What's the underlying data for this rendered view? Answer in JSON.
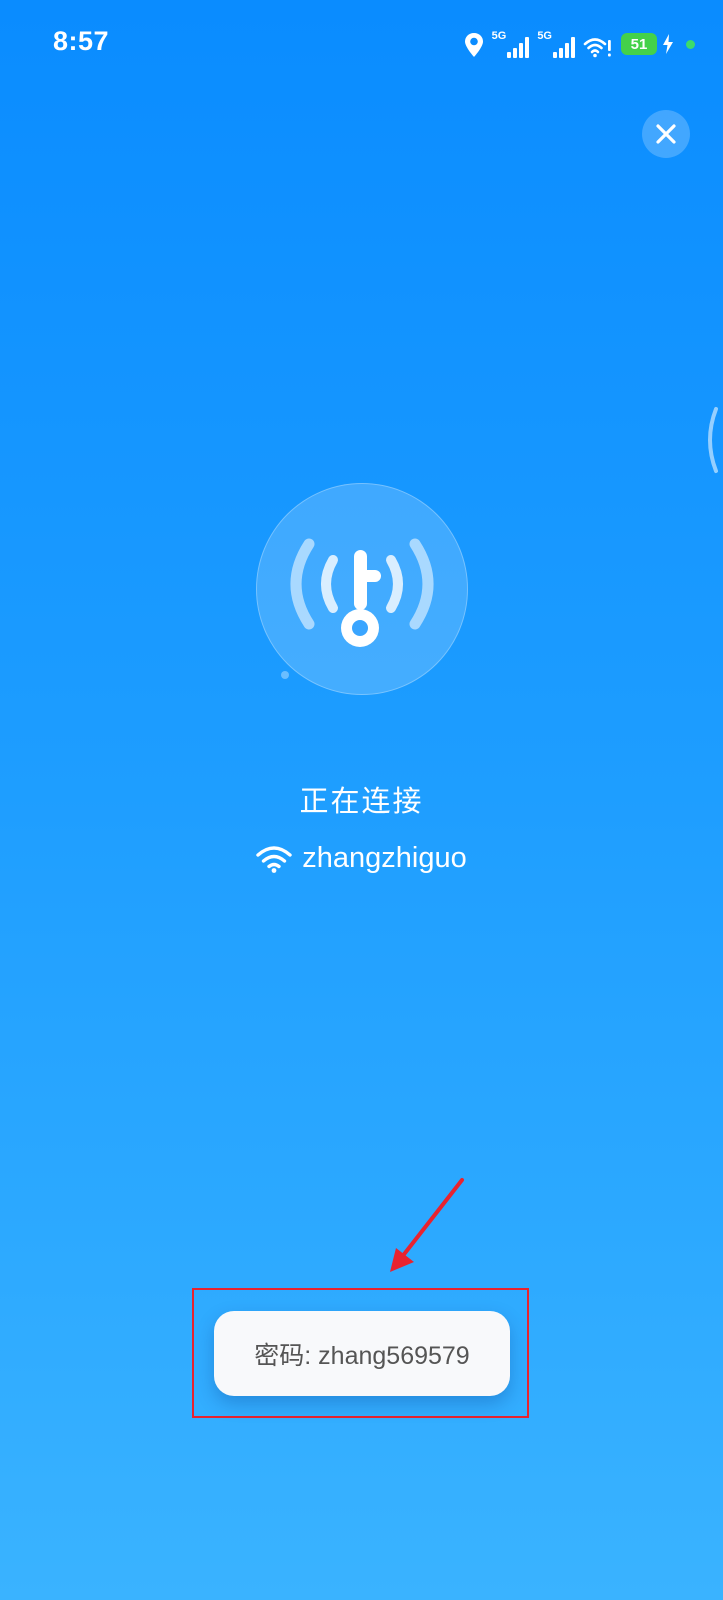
{
  "status_bar": {
    "time": "8:57",
    "network1_label": "5G",
    "network2_label": "5G",
    "battery_level": "51",
    "icons": [
      "location-icon",
      "signal-5g-icon",
      "signal-5g-icon",
      "wifi-warning-icon",
      "battery-icon",
      "charging-icon",
      "privacy-dot-icon"
    ]
  },
  "header": {
    "close_icon": "close-icon"
  },
  "main": {
    "logo_icon": "wifi-key-icon",
    "status_text": "正在连接",
    "ssid": "zhangzhiguo",
    "ssid_icon": "wifi-icon"
  },
  "toast": {
    "text": "密码: zhang569579"
  },
  "colors": {
    "background_top": "#0a8cff",
    "background_bottom": "#3ab3ff",
    "annotation": "#e8232f",
    "battery": "#44d14a"
  }
}
